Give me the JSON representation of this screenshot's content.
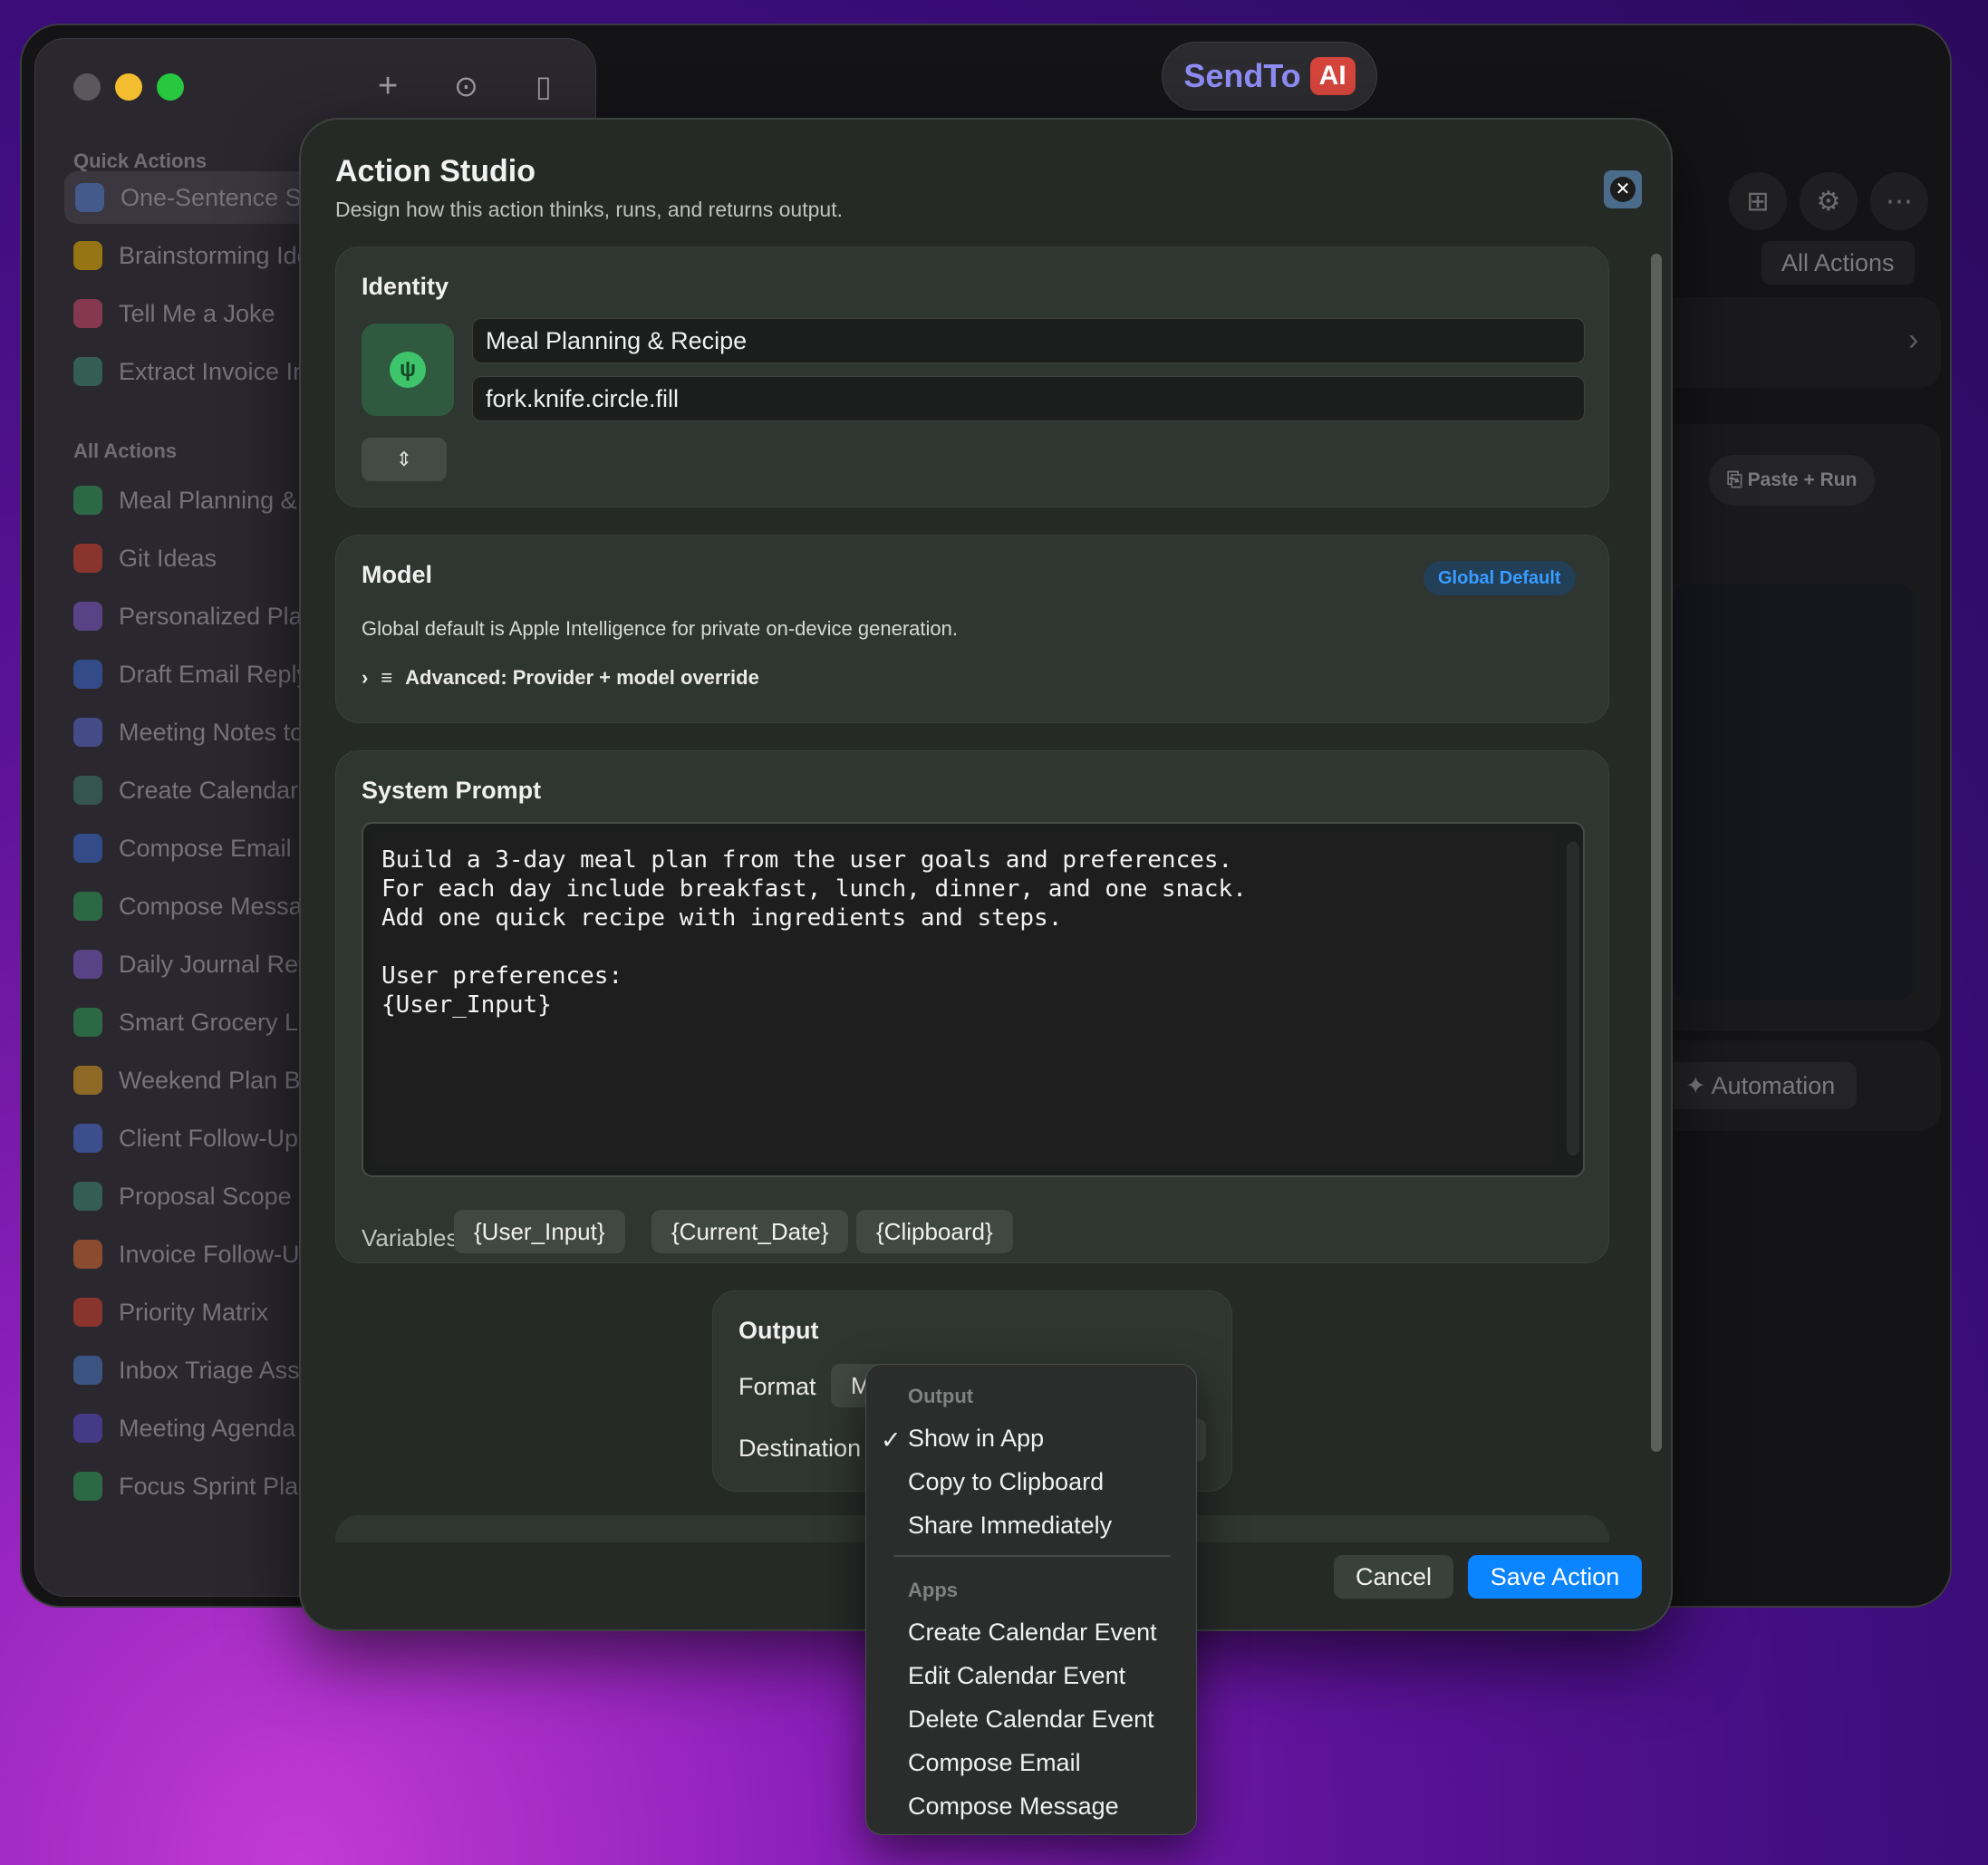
{
  "brand": {
    "name": "SendTo",
    "tag": "AI"
  },
  "sidebar": {
    "quick_actions_title": "Quick Actions",
    "quick_actions": [
      {
        "label": "One-Sentence Su",
        "color": "#4a78c8"
      },
      {
        "label": "Brainstorming Ide",
        "color": "#f0b400"
      },
      {
        "label": "Tell Me a Joke",
        "color": "#d1476e"
      },
      {
        "label": "Extract Invoice Inf",
        "color": "#3c8a73"
      }
    ],
    "all_actions_title": "All Actions",
    "all_actions": [
      {
        "label": "Meal Planning & R",
        "color": "#2f9e57"
      },
      {
        "label": "Git Ideas",
        "color": "#d9402f"
      },
      {
        "label": "Personalized Plan",
        "color": "#7d5bd0"
      },
      {
        "label": "Draft Email Reply",
        "color": "#3b6cd6"
      },
      {
        "label": "Meeting Notes to",
        "color": "#5a6ad0"
      },
      {
        "label": "Create Calendar E",
        "color": "#3c7b6e"
      },
      {
        "label": "Compose Email (",
        "color": "#3b6cd6"
      },
      {
        "label": "Compose Messag",
        "color": "#2f9e57"
      },
      {
        "label": "Daily Journal Refl",
        "color": "#7d5bd0"
      },
      {
        "label": "Smart Grocery Li",
        "color": "#2f9e57"
      },
      {
        "label": "Weekend Plan Bu",
        "color": "#e0a020"
      },
      {
        "label": "Client Follow-Up",
        "color": "#4a6fd8"
      },
      {
        "label": "Proposal Scope E",
        "color": "#3c8a73"
      },
      {
        "label": "Invoice Follow-Up",
        "color": "#d96a2f"
      },
      {
        "label": "Priority Matrix",
        "color": "#d9402f"
      },
      {
        "label": "Inbox Triage Assi",
        "color": "#4a7ac8"
      },
      {
        "label": "Meeting Agenda C",
        "color": "#5a4bd0"
      },
      {
        "label": "Focus Sprint Plan",
        "color": "#2f9e57"
      }
    ]
  },
  "right_pane": {
    "all_actions_btn": "All Actions",
    "paste_run": "Paste + Run",
    "automation": "Automation"
  },
  "modal": {
    "title": "Action Studio",
    "subtitle": "Design how this action thinks, runs, and returns output.",
    "identity": {
      "heading": "Identity",
      "name_value": "Meal Planning & Recipe",
      "symbol_value": "fork.knife.circle.fill"
    },
    "model": {
      "heading": "Model",
      "badge": "Global Default",
      "description": "Global default is Apple Intelligence for private on-device generation.",
      "advanced": "Advanced: Provider + model override"
    },
    "system_prompt": {
      "heading": "System Prompt",
      "text": "Build a 3-day meal plan from the user goals and preferences.\nFor each day include breakfast, lunch, dinner, and one snack.\nAdd one quick recipe with ingredients and steps.\n\nUser preferences:\n{User_Input}",
      "variables_label": "Variables",
      "variables": [
        "{User_Input}",
        "{Current_Date}",
        "{Clipboard}"
      ]
    },
    "output": {
      "heading": "Output",
      "format_label": "Format",
      "format_value": "M",
      "destination_label": "Destination"
    },
    "cancel": "Cancel",
    "save": "Save Action"
  },
  "dropdown": {
    "section_output": "Output",
    "output_items": [
      "Show in App",
      "Copy to Clipboard",
      "Share Immediately"
    ],
    "selected": "Show in App",
    "section_apps": "Apps",
    "app_items": [
      "Create Calendar Event",
      "Edit Calendar Event",
      "Delete Calendar Event",
      "Compose Email",
      "Compose Message"
    ]
  }
}
